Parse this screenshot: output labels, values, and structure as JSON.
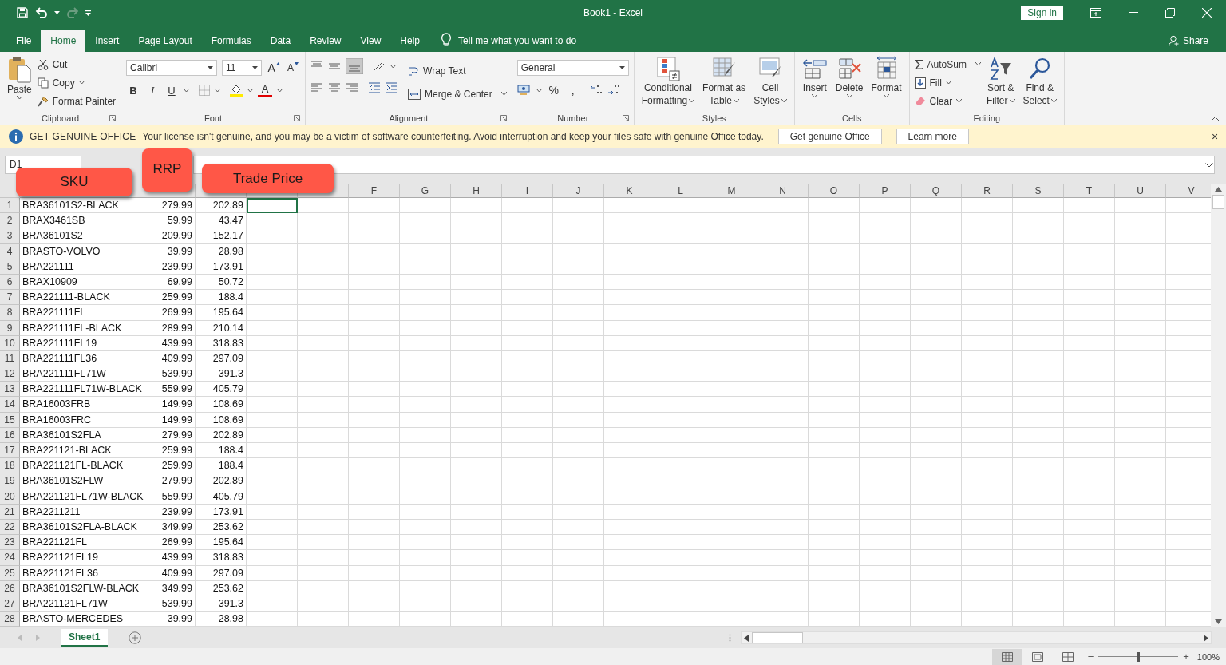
{
  "window": {
    "title": "Book1  -  Excel",
    "sign_in": "Sign in"
  },
  "tabs": [
    {
      "label": "File",
      "selected": false
    },
    {
      "label": "Home",
      "selected": true
    },
    {
      "label": "Insert",
      "selected": false
    },
    {
      "label": "Page Layout",
      "selected": false
    },
    {
      "label": "Formulas",
      "selected": false
    },
    {
      "label": "Data",
      "selected": false
    },
    {
      "label": "Review",
      "selected": false
    },
    {
      "label": "View",
      "selected": false
    },
    {
      "label": "Help",
      "selected": false
    }
  ],
  "tell_me": "Tell me what you want to do",
  "share": "Share",
  "ribbon": {
    "clipboard": {
      "paste": "Paste",
      "cut": "Cut",
      "copy": "Copy",
      "format_painter": "Format Painter",
      "label": "Clipboard"
    },
    "font": {
      "name": "Calibri",
      "size": "11",
      "grow": "A",
      "shrink": "A",
      "bold": "B",
      "italic": "I",
      "underline": "U",
      "font_color": "A",
      "label": "Font"
    },
    "alignment": {
      "wrap": "Wrap Text",
      "merge": "Merge & Center",
      "label": "Alignment"
    },
    "number": {
      "format": "General",
      "percent": "%",
      "comma": ",",
      "label": "Number"
    },
    "styles": {
      "items": [
        [
          "Conditional",
          "Formatting"
        ],
        [
          "Format as",
          "Table"
        ],
        [
          "Cell",
          "Styles"
        ]
      ],
      "label": "Styles"
    },
    "cells": {
      "items": [
        "Insert",
        "Delete",
        "Format"
      ],
      "label": "Cells"
    },
    "editing": {
      "autosum": "AutoSum",
      "fill": "Fill",
      "clear": "Clear",
      "sort": [
        "Sort &",
        "Filter"
      ],
      "find": [
        "Find &",
        "Select"
      ],
      "label": "Editing"
    }
  },
  "banner": {
    "title": "GET GENUINE OFFICE",
    "message": "Your license isn't genuine, and you may be a victim of software counterfeiting. Avoid interruption and keep your files safe with genuine Office today.",
    "buttons": [
      "Get genuine Office",
      "Learn more"
    ],
    "close": "×"
  },
  "name_box": "D1",
  "callouts": [
    "SKU",
    "RRP",
    "Trade Price"
  ],
  "column_headers": [
    "F",
    "G",
    "H",
    "I",
    "J",
    "K",
    "L",
    "M",
    "N",
    "O",
    "P",
    "Q",
    "R",
    "S",
    "T",
    "U",
    "V"
  ],
  "rows": [
    {
      "number": "1",
      "cells": [
        "BRA36101S2-BLACK",
        "279.99",
        "202.89"
      ],
      "active_cell": true
    },
    {
      "number": "2",
      "cells": [
        "BRAX3461SB",
        "59.99",
        "43.47"
      ],
      "active_cell": false
    },
    {
      "number": "3",
      "cells": [
        "BRA36101S2",
        "209.99",
        "152.17"
      ],
      "active_cell": false
    },
    {
      "number": "4",
      "cells": [
        "BRASTO-VOLVO",
        "39.99",
        "28.98"
      ],
      "active_cell": false
    },
    {
      "number": "5",
      "cells": [
        "BRA221111",
        "239.99",
        "173.91"
      ],
      "active_cell": false
    },
    {
      "number": "6",
      "cells": [
        "BRAX10909",
        "69.99",
        "50.72"
      ],
      "active_cell": false
    },
    {
      "number": "7",
      "cells": [
        "BRA221111-BLACK",
        "259.99",
        "188.4"
      ],
      "active_cell": false
    },
    {
      "number": "8",
      "cells": [
        "BRA221111FL",
        "269.99",
        "195.64"
      ],
      "active_cell": false
    },
    {
      "number": "9",
      "cells": [
        "BRA221111FL-BLACK",
        "289.99",
        "210.14"
      ],
      "active_cell": false
    },
    {
      "number": "10",
      "cells": [
        "BRA221111FL19",
        "439.99",
        "318.83"
      ],
      "active_cell": false
    },
    {
      "number": "11",
      "cells": [
        "BRA221111FL36",
        "409.99",
        "297.09"
      ],
      "active_cell": false
    },
    {
      "number": "12",
      "cells": [
        "BRA221111FL71W",
        "539.99",
        "391.3"
      ],
      "active_cell": false
    },
    {
      "number": "13",
      "cells": [
        "BRA221111FL71W-BLACK",
        "559.99",
        "405.79"
      ],
      "active_cell": false
    },
    {
      "number": "14",
      "cells": [
        "BRA16003FRB",
        "149.99",
        "108.69"
      ],
      "active_cell": false
    },
    {
      "number": "15",
      "cells": [
        "BRA16003FRC",
        "149.99",
        "108.69"
      ],
      "active_cell": false
    },
    {
      "number": "16",
      "cells": [
        "BRA36101S2FLA",
        "279.99",
        "202.89"
      ],
      "active_cell": false
    },
    {
      "number": "17",
      "cells": [
        "BRA221121-BLACK",
        "259.99",
        "188.4"
      ],
      "active_cell": false
    },
    {
      "number": "18",
      "cells": [
        "BRA221121FL-BLACK",
        "259.99",
        "188.4"
      ],
      "active_cell": false
    },
    {
      "number": "19",
      "cells": [
        "BRA36101S2FLW",
        "279.99",
        "202.89"
      ],
      "active_cell": false
    },
    {
      "number": "20",
      "cells": [
        "BRA221121FL71W-BLACK",
        "559.99",
        "405.79"
      ],
      "active_cell": false
    },
    {
      "number": "21",
      "cells": [
        "BRA2211211",
        "239.99",
        "173.91"
      ],
      "active_cell": false
    },
    {
      "number": "22",
      "cells": [
        "BRA36101S2FLA-BLACK",
        "349.99",
        "253.62"
      ],
      "active_cell": false
    },
    {
      "number": "23",
      "cells": [
        "BRA221121FL",
        "269.99",
        "195.64"
      ],
      "active_cell": false
    },
    {
      "number": "24",
      "cells": [
        "BRA221121FL19",
        "439.99",
        "318.83"
      ],
      "active_cell": false
    },
    {
      "number": "25",
      "cells": [
        "BRA221121FL36",
        "409.99",
        "297.09"
      ],
      "active_cell": false
    },
    {
      "number": "26",
      "cells": [
        "BRA36101S2FLW-BLACK",
        "349.99",
        "253.62"
      ],
      "active_cell": false
    },
    {
      "number": "27",
      "cells": [
        "BRA221121FL71W",
        "539.99",
        "391.3"
      ],
      "active_cell": false
    },
    {
      "number": "28",
      "cells": [
        "BRASTO-MERCEDES",
        "39.99",
        "28.98"
      ],
      "active_cell": false
    }
  ],
  "sheets": [
    {
      "label": "Sheet1",
      "selected": true
    }
  ],
  "status": {
    "zoom": "100%",
    "minus": "−",
    "plus": "+",
    "level": 0.5
  }
}
